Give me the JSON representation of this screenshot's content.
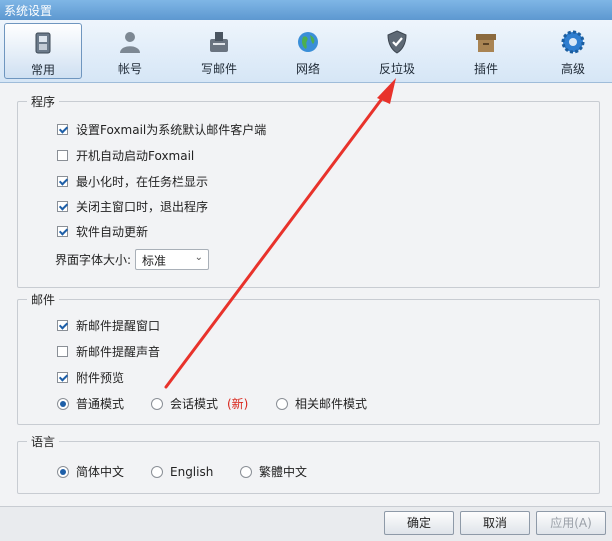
{
  "window": {
    "title": "系统设置"
  },
  "tabs": [
    {
      "label": "常用",
      "icon": "phone-icon",
      "active": true
    },
    {
      "label": "帐号",
      "icon": "user-icon",
      "active": false
    },
    {
      "label": "写邮件",
      "icon": "compose-icon",
      "active": false
    },
    {
      "label": "网络",
      "icon": "globe-icon",
      "active": false
    },
    {
      "label": "反垃圾",
      "icon": "shield-icon",
      "active": false
    },
    {
      "label": "插件",
      "icon": "box-icon",
      "active": false
    },
    {
      "label": "高级",
      "icon": "gear-icon",
      "active": false
    }
  ],
  "program": {
    "title": "程序",
    "options": [
      {
        "label": "设置Foxmail为系统默认邮件客户端",
        "checked": true
      },
      {
        "label": "开机自动启动Foxmail",
        "checked": false
      },
      {
        "label": "最小化时，在任务栏显示",
        "checked": true
      },
      {
        "label": "关闭主窗口时，退出程序",
        "checked": true
      },
      {
        "label": "软件自动更新",
        "checked": true
      }
    ],
    "font_size_label": "界面字体大小:",
    "font_size_value": "标准"
  },
  "mail": {
    "title": "邮件",
    "options": [
      {
        "label": "新邮件提醒窗口",
        "checked": true
      },
      {
        "label": "新邮件提醒声音",
        "checked": false
      },
      {
        "label": "附件预览",
        "checked": true
      }
    ],
    "modes": [
      {
        "label": "普通模式",
        "selected": true
      },
      {
        "label": "会话模式",
        "badge": "(新)",
        "selected": false
      },
      {
        "label": "相关邮件模式",
        "selected": false
      }
    ]
  },
  "language": {
    "title": "语言",
    "options": [
      {
        "label": "简体中文",
        "selected": true
      },
      {
        "label": "English",
        "selected": false
      },
      {
        "label": "繁體中文",
        "selected": false
      }
    ]
  },
  "footer": {
    "ok": "确定",
    "cancel": "取消",
    "apply": "应用(A)"
  },
  "annotation": {
    "color": "#e8322b"
  }
}
